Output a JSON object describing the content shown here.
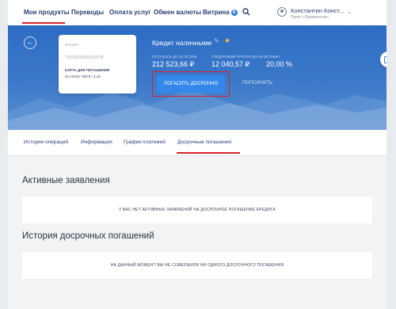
{
  "nav": {
    "items": [
      {
        "label": "Мои продукты"
      },
      {
        "label": "Переводы"
      },
      {
        "label": "Оплата услуг"
      },
      {
        "label": "Обмен валюты"
      },
      {
        "label": "Витрина",
        "badge": "6"
      }
    ],
    "user": {
      "name": "Константин Конст...",
      "subtitle": "Пакет «Привилегия»"
    }
  },
  "card": {
    "type": "КРЕДИТ",
    "number": "7312520000011578",
    "label": "КАРТА ДЛЯ ПОГАШЕНИЯ",
    "account": "CLASSIC *5678 / 2.19"
  },
  "loan": {
    "title": "Кредит наличными",
    "fields": [
      {
        "label": "ОСТАЛОСЬ ДО 10.10.2025",
        "value": "212 523,66 ₽"
      },
      {
        "label": "СЛЕДУЮЩИЙ ПЛАТЕЖ ДО 05.04",
        "value": "12 040,57 ₽"
      },
      {
        "label": "СТАВКА",
        "value": "20,00 %"
      }
    ],
    "repay_button": "ПОГАСИТЬ ДОСРОЧНО",
    "topup_label": "ПОПОЛНИТЬ"
  },
  "tabs": [
    {
      "label": "История операций"
    },
    {
      "label": "Информация"
    },
    {
      "label": "График платежей"
    },
    {
      "label": "Досрочные погашения",
      "active": true
    }
  ],
  "active_requests": {
    "title": "Активные заявления",
    "empty_text": "У ВАС НЕТ АКТИВНЫХ ЗАЯВЛЕНИЙ НА ДОСРОЧНОЕ ПОГАШЕНИЕ КРЕДИТА"
  },
  "history": {
    "title": "История досрочных погашений",
    "empty_text": "НА ДАННЫЙ МОМЕНТ ВЫ НЕ СОВЕРШИЛИ НИ ОДНОГО ДОСРОЧНОГО ПОГАШЕНИЯ"
  },
  "colors": {
    "accent": "#d9232e",
    "primary": "#3588ea",
    "hero": "#2d6cc4",
    "nav_text": "#2a3f6e"
  }
}
